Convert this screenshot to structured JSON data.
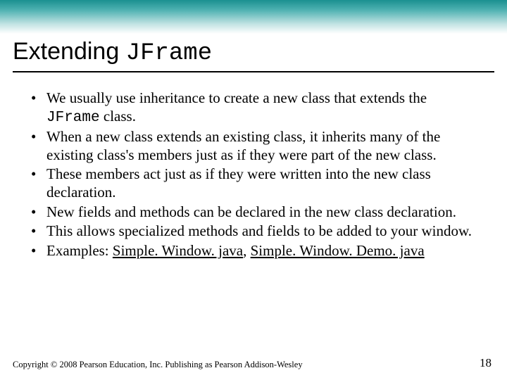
{
  "title": {
    "prefix": "Extending ",
    "code": "JFrame"
  },
  "bullets": [
    {
      "pre": "We usually use inheritance to create a new class that extends the ",
      "code": "JFrame",
      "post": " class."
    },
    {
      "pre": "When a new class extends an existing class, it inherits many of the existing class's members just as if they were part of the new class.",
      "code": "",
      "post": ""
    },
    {
      "pre": "These members act just as if they were written into the new class declaration.",
      "code": "",
      "post": ""
    },
    {
      "pre": "New fields and methods can be declared in the new class declaration.",
      "code": "",
      "post": ""
    },
    {
      "pre": "This allows specialized methods and fields to be added to your window.",
      "code": "",
      "post": ""
    },
    {
      "pre": "Examples: ",
      "link1": "Simple. Window. java",
      "sep": ", ",
      "link2": "Simple. Window. Demo. java"
    }
  ],
  "footer": "Copyright © 2008 Pearson Education, Inc. Publishing as Pearson Addison-Wesley",
  "page_number": "18"
}
